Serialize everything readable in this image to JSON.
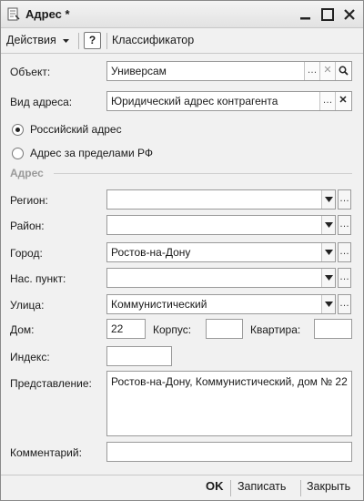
{
  "window": {
    "title": "Адрес",
    "modified_mark": "*",
    "icons": {
      "app": "document-icon",
      "minimize": "minimize-icon",
      "maximize": "maximize-icon",
      "close": "close-icon"
    }
  },
  "toolbar": {
    "actions_label": "Действия",
    "help_label": "?",
    "classifier_label": "Классификатор"
  },
  "form": {
    "object": {
      "label": "Объект:",
      "value": "Универсам"
    },
    "address_type": {
      "label": "Вид адреса:",
      "value": "Юридический адрес контрагента"
    },
    "radio_russian": {
      "label": "Российский адрес",
      "selected": true
    },
    "radio_foreign": {
      "label": "Адрес за пределами РФ",
      "selected": false
    },
    "section_title": "Адрес",
    "region": {
      "label": "Регион:",
      "value": ""
    },
    "district": {
      "label": "Район:",
      "value": ""
    },
    "city": {
      "label": "Город:",
      "value": "Ростов-на-Дону"
    },
    "settlement": {
      "label": "Нас. пункт:",
      "value": ""
    },
    "street": {
      "label": "Улица:",
      "value": "Коммунистический"
    },
    "house": {
      "label": "Дом:",
      "value": "22"
    },
    "building": {
      "label": "Корпус:",
      "value": ""
    },
    "apartment": {
      "label": "Квартира:",
      "value": ""
    },
    "postcode": {
      "label": "Индекс:",
      "value": ""
    },
    "presentation": {
      "label": "Представление:",
      "value": "Ростов-на-Дону, Коммунистический, дом № 22"
    },
    "comment": {
      "label": "Комментарий:",
      "value": ""
    }
  },
  "buttons": {
    "ok": "OK",
    "save": "Записать",
    "close": "Закрыть"
  }
}
